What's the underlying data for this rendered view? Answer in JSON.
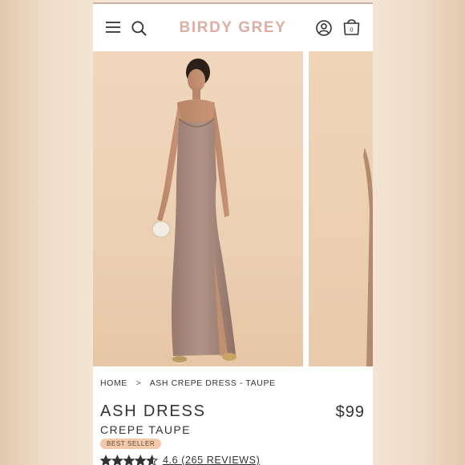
{
  "header": {
    "brand": "BIRDY GREY",
    "bag_count": "0",
    "icons": [
      "menu-icon",
      "search-icon",
      "account-icon",
      "bag-icon"
    ]
  },
  "gallery": {
    "images": [
      "model-wearing-ash-dress-front",
      "model-wearing-ash-dress-side"
    ]
  },
  "breadcrumb": {
    "home": "HOME",
    "separator": ">",
    "current": "ASH CREPE DRESS - TAUPE"
  },
  "product": {
    "name": "ASH DRESS",
    "variant": "CREPE TAUPE",
    "price": "$99",
    "badge": "BEST SELLER",
    "rating": 4.6,
    "reviews_label": "4.6 (265 REVIEWS)"
  },
  "colors": {
    "brand": "#dcaea3",
    "badge": "#f3c9a9",
    "text": "#333333",
    "dress": "#a58a7e"
  }
}
